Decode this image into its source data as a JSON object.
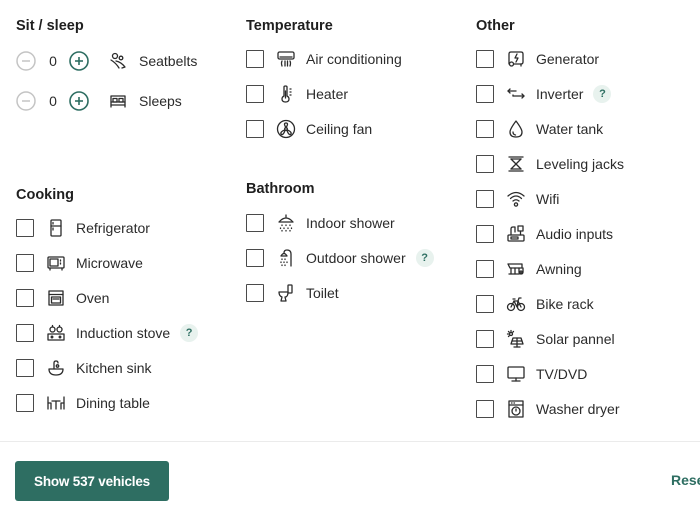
{
  "sit_sleep": {
    "title": "Sit / sleep",
    "steppers": [
      {
        "label": "Seatbelts",
        "value": "0",
        "icon": "seatbelt-icon"
      },
      {
        "label": "Sleeps",
        "value": "0",
        "icon": "bed-icon"
      }
    ]
  },
  "cooking": {
    "title": "Cooking",
    "items": [
      {
        "label": "Refrigerator",
        "icon": "refrigerator-icon",
        "checked": false
      },
      {
        "label": "Microwave",
        "icon": "microwave-icon",
        "checked": false
      },
      {
        "label": "Oven",
        "icon": "oven-icon",
        "checked": false
      },
      {
        "label": "Induction stove",
        "icon": "induction-stove-icon",
        "checked": false,
        "help": "?"
      },
      {
        "label": "Kitchen sink",
        "icon": "kitchen-sink-icon",
        "checked": false
      },
      {
        "label": "Dining table",
        "icon": "dining-table-icon",
        "checked": false
      }
    ]
  },
  "temperature": {
    "title": "Temperature",
    "items": [
      {
        "label": "Air conditioning",
        "icon": "air-conditioning-icon",
        "checked": false
      },
      {
        "label": "Heater",
        "icon": "thermometer-icon",
        "checked": false
      },
      {
        "label": "Ceiling fan",
        "icon": "fan-icon",
        "checked": false
      }
    ]
  },
  "bathroom": {
    "title": "Bathroom",
    "items": [
      {
        "label": "Indoor shower",
        "icon": "indoor-shower-icon",
        "checked": false
      },
      {
        "label": "Outdoor shower",
        "icon": "outdoor-shower-icon",
        "checked": false,
        "help": "?"
      },
      {
        "label": "Toilet",
        "icon": "toilet-icon",
        "checked": false
      }
    ]
  },
  "other": {
    "title": "Other",
    "items": [
      {
        "label": "Generator",
        "icon": "generator-icon",
        "checked": false
      },
      {
        "label": "Inverter",
        "icon": "inverter-icon",
        "checked": false,
        "help": "?"
      },
      {
        "label": "Water tank",
        "icon": "water-drop-icon",
        "checked": false
      },
      {
        "label": "Leveling jacks",
        "icon": "leveling-jacks-icon",
        "checked": false
      },
      {
        "label": "Wifi",
        "icon": "wifi-icon",
        "checked": false
      },
      {
        "label": "Audio inputs",
        "icon": "audio-inputs-icon",
        "checked": false
      },
      {
        "label": "Awning",
        "icon": "awning-icon",
        "checked": false
      },
      {
        "label": "Bike rack",
        "icon": "bike-icon",
        "checked": false
      },
      {
        "label": "Solar pannel",
        "icon": "solar-panel-icon",
        "checked": false
      },
      {
        "label": "TV/DVD",
        "icon": "tv-icon",
        "checked": false
      },
      {
        "label": "Washer dryer",
        "icon": "washer-dryer-icon",
        "checked": false
      }
    ]
  },
  "footer": {
    "show_button": "Show 537 vehicles",
    "reset_link": "Reset"
  },
  "colors": {
    "accent": "#2e6e62",
    "help_bg": "#e8f2ee",
    "disabled": "#bdbdbd"
  }
}
